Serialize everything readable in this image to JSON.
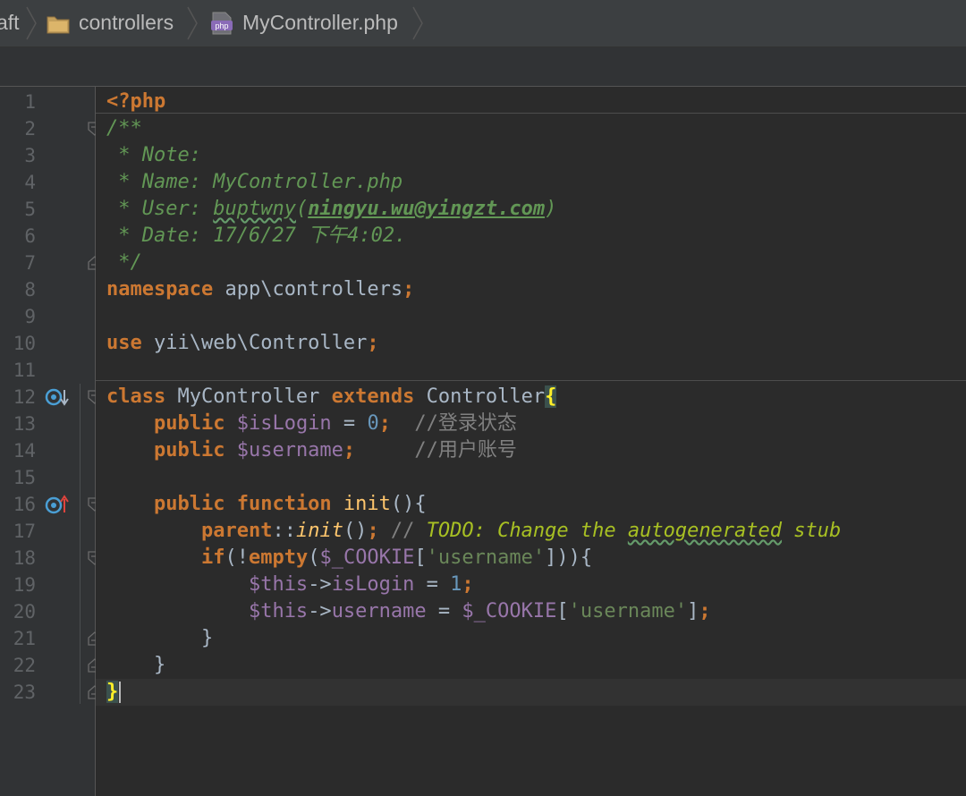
{
  "breadcrumb": {
    "items": [
      {
        "label": "aft",
        "icon": "none"
      },
      {
        "label": "controllers",
        "icon": "folder-icon"
      },
      {
        "label": "MyController.php",
        "icon": "php-file-icon"
      }
    ]
  },
  "editor": {
    "line_numbers": [
      "1",
      "2",
      "3",
      "4",
      "5",
      "6",
      "7",
      "8",
      "9",
      "10",
      "11",
      "12",
      "13",
      "14",
      "15",
      "16",
      "17",
      "18",
      "19",
      "20",
      "21",
      "22",
      "23"
    ],
    "gutter_markers": [
      {
        "line": "12",
        "icon": "implements-down-icon"
      },
      {
        "line": "16",
        "icon": "overrides-up-icon"
      }
    ],
    "code": {
      "l1": "<?php",
      "l2": "/**",
      "l3": " * Note:",
      "l4": " * Name: MyController.php",
      "l5_a": " * User: ",
      "l5_b": "buptwny",
      "l5_c": "(",
      "l5_d": "ningyu.wu@yingzt.com",
      "l5_e": ")",
      "l6": " * Date: 17/6/27 下午4:02.",
      "l7": " */",
      "l8_kw": "namespace",
      "l8_rest": " app\\controllers",
      "l8_semi": ";",
      "l10_kw": "use",
      "l10_rest": " yii\\web\\Controller",
      "l10_semi": ";",
      "l12_kw1": "class",
      "l12_name": " MyController ",
      "l12_kw2": "extends",
      "l12_parent": " Controller",
      "l12_brace": "{",
      "l13_indent": "    ",
      "l13_kw": "public",
      "l13_var": " $isLogin",
      "l13_eq": " = ",
      "l13_num": "0",
      "l13_semi": ";",
      "l13_cm": "  //登录状态",
      "l14_indent": "    ",
      "l14_kw": "public",
      "l14_var": " $username",
      "l14_semi": ";",
      "l14_cm": "     //用户账号",
      "l16_indent": "    ",
      "l16_kw1": "public",
      "l16_kw2": " function",
      "l16_fn": " init",
      "l16_rest": "(){",
      "l17_indent": "        ",
      "l17_kw": "parent",
      "l17_op": "::",
      "l17_fn": "init",
      "l17_paren": "()",
      "l17_semi": ";",
      "l17_cm": " // ",
      "l17_todo_a": "TODO: Change the ",
      "l17_todo_b": "autogenerated",
      "l17_todo_c": " stub",
      "l18_indent": "        ",
      "l18_kw": "if",
      "l18_p1": "(!",
      "l18_kw2": "empty",
      "l18_p2": "(",
      "l18_var": "$_COOKIE",
      "l18_b1": "[",
      "l18_str": "'username'",
      "l18_b2": "])){",
      "l19_indent": "            ",
      "l19_var": "$this",
      "l19_arrow": "->",
      "l19_prop": "isLogin",
      "l19_eq": " = ",
      "l19_num": "1",
      "l19_semi": ";",
      "l20_indent": "            ",
      "l20_var": "$this",
      "l20_arrow": "->",
      "l20_prop": "username",
      "l20_eq": " = ",
      "l20_var2": "$_COOKIE",
      "l20_b1": "[",
      "l20_str": "'username'",
      "l20_b2": "]",
      "l20_semi": ";",
      "l21": "        }",
      "l22": "    }",
      "l23": "}"
    }
  },
  "colors": {
    "keyword": "#cc7832",
    "comment": "#629755",
    "variable": "#9876aa",
    "number": "#6897bb",
    "string": "#6a8759",
    "todo": "#a8c023",
    "background": "#2b2b2b",
    "gutter": "#313335"
  }
}
